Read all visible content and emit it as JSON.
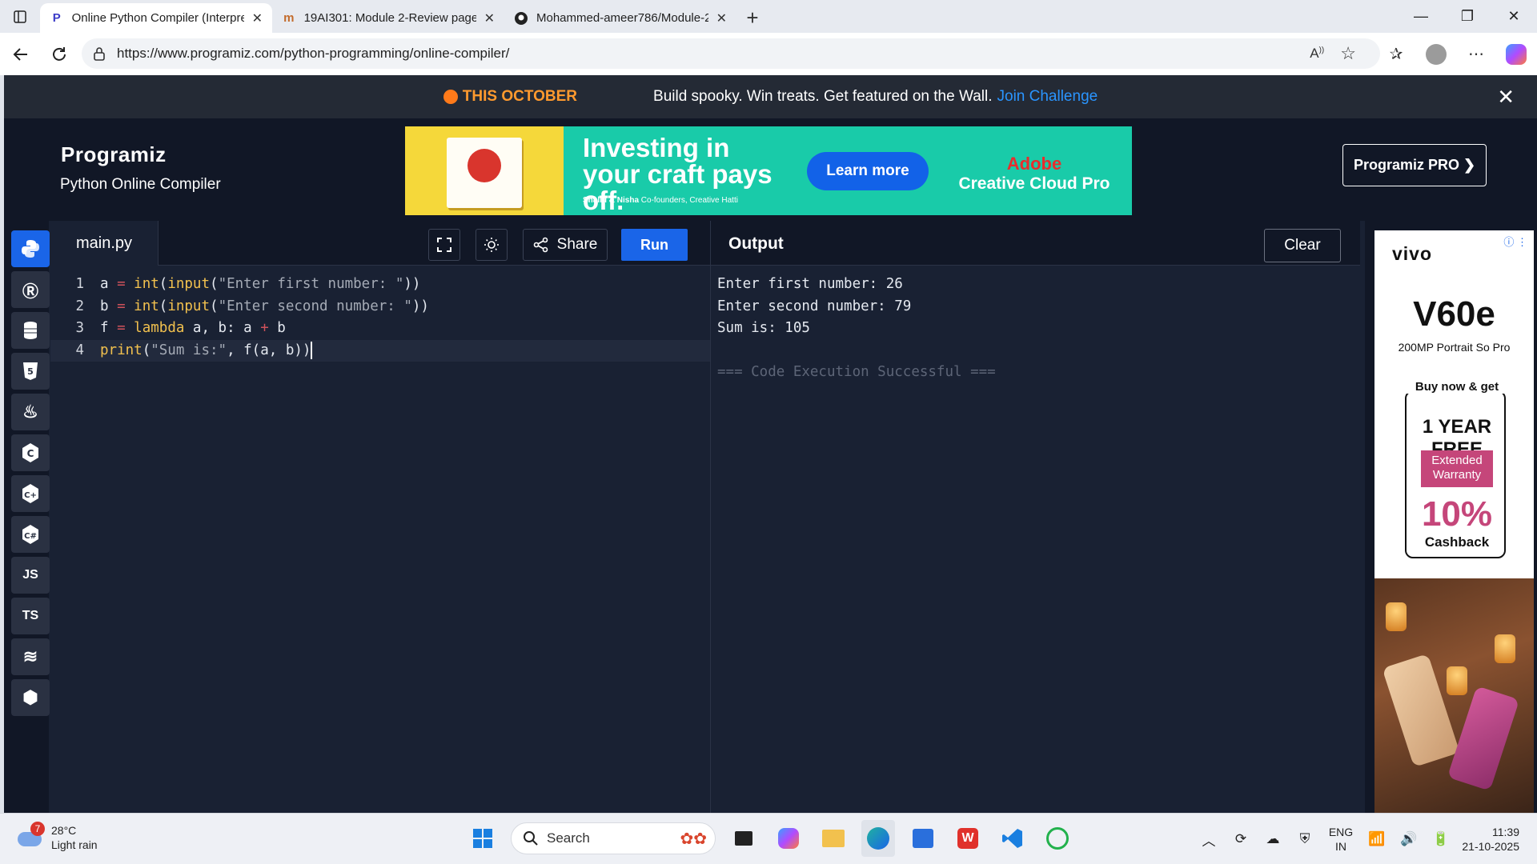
{
  "browser": {
    "tabs": [
      {
        "title": "Online Python Compiler (Interpre",
        "active": true
      },
      {
        "title": "19AI301: Module 2-Review page f",
        "active": false
      },
      {
        "title": "Mohammed-ameer786/Module-2",
        "active": false
      }
    ],
    "url": "https://www.programiz.com/python-programming/online-compiler/"
  },
  "promo": {
    "badge": "THIS OCTOBER",
    "text": "Build spooky. Win treats. Get featured on the Wall.",
    "link": "Join Challenge"
  },
  "header": {
    "logo": "Programiz",
    "subtitle": "Python Online Compiler",
    "pro_button": "Programiz PRO ❯"
  },
  "ad": {
    "headline": "Investing in your craft pays off.",
    "small_bold": "Shallu & Nisha",
    "small": " Co-founders, Creative Hatti",
    "cta": "Learn more",
    "brand1": "Adobe",
    "brand2": "Creative Cloud Pro"
  },
  "sidebar": {
    "langs": [
      "python",
      "r",
      "sql",
      "html",
      "java",
      "c",
      "cpp",
      "csharp",
      "JS",
      "TS",
      "swift",
      "go"
    ]
  },
  "editor": {
    "filename": "main.py",
    "share_label": "Share",
    "run_label": "Run",
    "lines": [
      "1",
      "2",
      "3",
      "4"
    ]
  },
  "output": {
    "title": "Output",
    "clear_label": "Clear",
    "lines": [
      "Enter first number: 26",
      "Enter second number: 79",
      "Sum is: 105",
      "",
      "=== Code Execution Successful ==="
    ]
  },
  "side_ad": {
    "brand": "vivo",
    "model": "V60e",
    "sub": "200MP Portrait So Pro",
    "offer1": "Buy now & get",
    "offer2": "1 YEAR FREE",
    "offer3": "Extended Warranty",
    "offer4": "10%",
    "offer5": "Cashback"
  },
  "taskbar": {
    "temp": "28°C",
    "weather": "Light rain",
    "weather_badge": "7",
    "search": "Search",
    "lang1": "ENG",
    "lang2": "IN",
    "time": "11:39",
    "date": "21-10-2025"
  },
  "colors": {
    "accent": "#1a65e8",
    "page_bg": "#192133",
    "promo_orange": "#ff9a2e",
    "keyword": "#f2c14e"
  }
}
